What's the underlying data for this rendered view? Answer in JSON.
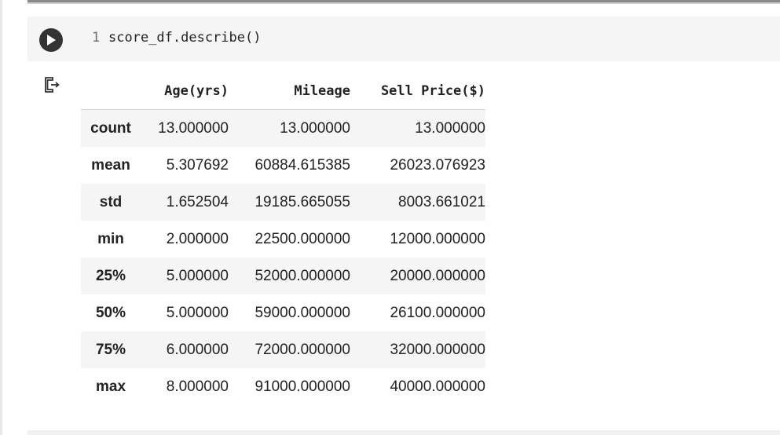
{
  "cell": {
    "line_number": "1",
    "code": "score_df.describe()"
  },
  "icons": {
    "run": "play-icon",
    "output": "output-redirect-icon"
  },
  "table": {
    "columns": [
      "Age(yrs)",
      "Mileage",
      "Sell Price($)"
    ],
    "rows": [
      {
        "label": "count",
        "values": [
          "13.000000",
          "13.000000",
          "13.000000"
        ]
      },
      {
        "label": "mean",
        "values": [
          "5.307692",
          "60884.615385",
          "26023.076923"
        ]
      },
      {
        "label": "std",
        "values": [
          "1.652504",
          "19185.665055",
          "8003.661021"
        ]
      },
      {
        "label": "min",
        "values": [
          "2.000000",
          "22500.000000",
          "12000.000000"
        ]
      },
      {
        "label": "25%",
        "values": [
          "5.000000",
          "52000.000000",
          "20000.000000"
        ]
      },
      {
        "label": "50%",
        "values": [
          "5.000000",
          "59000.000000",
          "26100.000000"
        ]
      },
      {
        "label": "75%",
        "values": [
          "6.000000",
          "72000.000000",
          "32000.000000"
        ]
      },
      {
        "label": "max",
        "values": [
          "8.000000",
          "91000.000000",
          "40000.000000"
        ]
      }
    ]
  }
}
